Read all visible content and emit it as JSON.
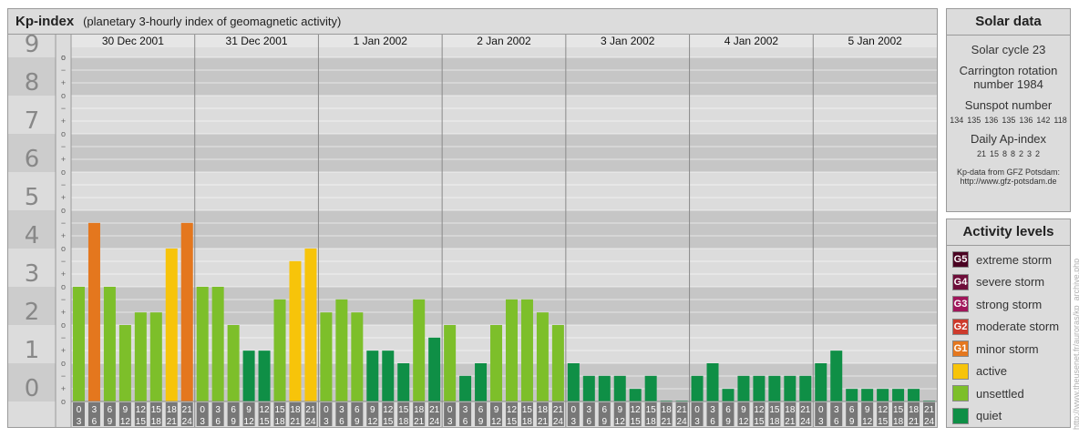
{
  "header": {
    "title": "Kp-index",
    "subtitle": "(planetary 3-hourly index of geomagnetic activity)"
  },
  "chart_data": {
    "type": "bar",
    "title": "Kp-index",
    "subtitle": "(planetary 3-hourly index of geomagnetic activity)",
    "days": [
      "30 Dec 2001",
      "31 Dec 2001",
      "1 Jan 2002",
      "2 Jan 2002",
      "3 Jan 2002",
      "4 Jan 2002",
      "5 Jan 2002"
    ],
    "hour_ranges": [
      [
        "0",
        "3"
      ],
      [
        "3",
        "6"
      ],
      [
        "6",
        "9"
      ],
      [
        "9",
        "12"
      ],
      [
        "12",
        "15"
      ],
      [
        "15",
        "18"
      ],
      [
        "18",
        "21"
      ],
      [
        "21",
        "24"
      ]
    ],
    "y_ticks": [
      "0",
      "1",
      "2",
      "3",
      "4",
      "5",
      "6",
      "7",
      "8",
      "9"
    ],
    "y_subticks": [
      "+",
      "o",
      "−"
    ],
    "ylim": [
      0,
      9.33
    ],
    "values": [
      [
        3.0,
        4.67,
        3.0,
        2.0,
        2.33,
        2.33,
        4.0,
        4.67
      ],
      [
        3.0,
        3.0,
        2.0,
        1.33,
        1.33,
        2.67,
        3.67,
        4.0
      ],
      [
        2.33,
        2.67,
        2.33,
        1.33,
        1.33,
        1.0,
        2.67,
        1.67
      ],
      [
        2.0,
        0.67,
        1.0,
        2.0,
        2.67,
        2.67,
        2.33,
        2.0
      ],
      [
        1.0,
        0.67,
        0.67,
        0.67,
        0.33,
        0.67,
        0.0,
        0.0
      ],
      [
        0.67,
        1.0,
        0.33,
        0.67,
        0.67,
        0.67,
        0.67,
        0.67
      ],
      [
        1.0,
        1.33,
        0.33,
        0.33,
        0.33,
        0.33,
        0.33,
        0.0
      ]
    ],
    "colors": {
      "quiet": "#0f8f46",
      "unsettled": "#7dbf2a",
      "active": "#f7c40a",
      "minor": "#e4771e",
      "moderate": "#cd3a2c",
      "strong": "#a0165a",
      "severe": "#6e0e3a",
      "extreme": "#4a0222"
    },
    "grid": true
  },
  "solar": {
    "title": "Solar data",
    "cycle": "Solar cycle 23",
    "carrington_line1": "Carrington rotation",
    "carrington_line2": "number 1984",
    "sunspot_label": "Sunspot number",
    "sunspot_values": [
      "134",
      "135",
      "136",
      "135",
      "136",
      "142",
      "118"
    ],
    "ap_label": "Daily Ap-index",
    "ap_values": [
      "21",
      "15",
      "8",
      "8",
      "2",
      "3",
      "2"
    ],
    "credit_line1": "Kp-data from  GFZ Potsdam:",
    "credit_line2": "http://www.gfz-potsdam.de"
  },
  "levels": {
    "title": "Activity levels",
    "items": [
      {
        "code": "G5",
        "label": "extreme storm",
        "color": "#4a0222"
      },
      {
        "code": "G4",
        "label": "severe storm",
        "color": "#6e0e3a"
      },
      {
        "code": "G3",
        "label": "strong storm",
        "color": "#a0165a"
      },
      {
        "code": "G2",
        "label": "moderate storm",
        "color": "#cd3a2c"
      },
      {
        "code": "G1",
        "label": "minor storm",
        "color": "#e4771e"
      },
      {
        "code": "",
        "label": "active",
        "color": "#f7c40a"
      },
      {
        "code": "",
        "label": "unsettled",
        "color": "#7dbf2a"
      },
      {
        "code": "",
        "label": "quiet",
        "color": "#0f8f46"
      }
    ]
  },
  "watermark": "http://www.theusenet.fr/auroras/kp_archive.php"
}
